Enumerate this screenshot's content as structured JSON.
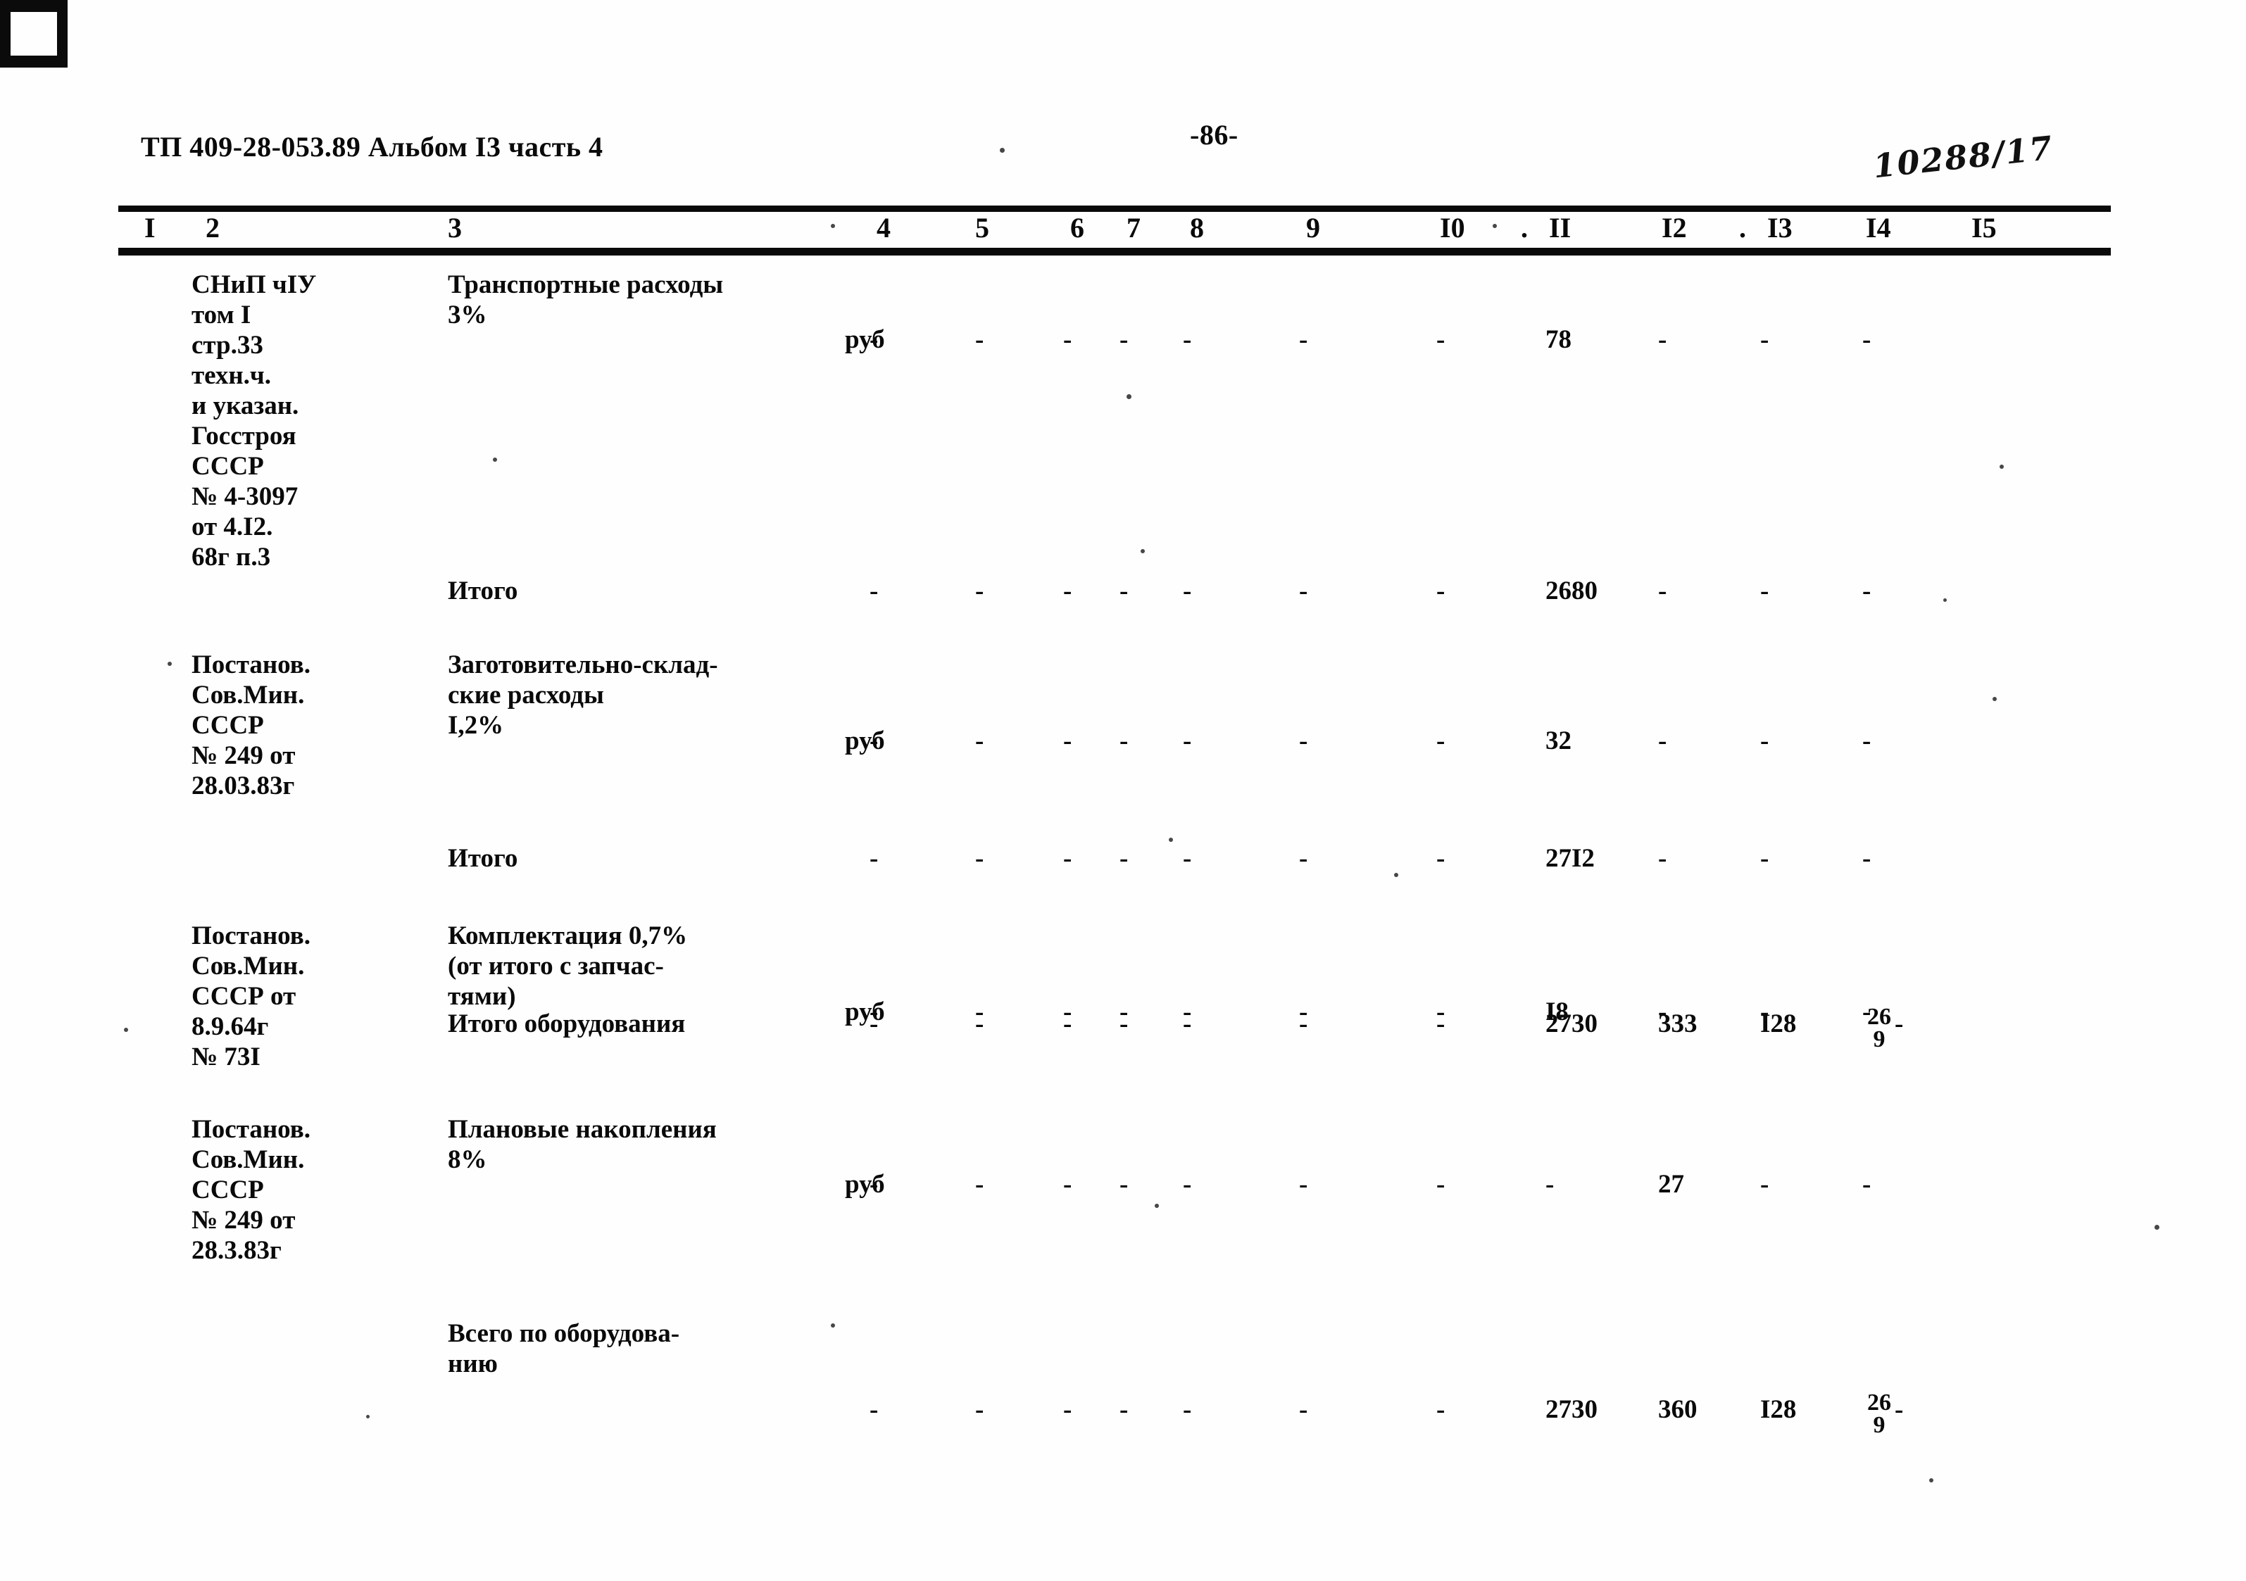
{
  "document": {
    "header_left": "ТП 409-28-053.89 Альбом I3 часть 4",
    "page_number": "-86-",
    "handwritten_note": "10288/17"
  },
  "table": {
    "column_headers": [
      "I",
      "2",
      "3",
      "4",
      "5",
      "6",
      "7",
      "8",
      "9",
      "I0",
      "II",
      "I2",
      "I3",
      "I4",
      "I5"
    ],
    "rows": [
      {
        "id": "row-transport",
        "col2": "СНиП чIУ\nтом I\nстр.33\nтехн.ч.\nи указан.\nГосстроя\nСССР\n№ 4-3097\nот 4.I2.\n68г п.3",
        "col3": "Транспортные расходы\n3%",
        "unit": "руб",
        "values": [
          "-",
          "-",
          "-",
          "-",
          "-",
          "-",
          "-",
          "78",
          "-",
          "-",
          "-"
        ]
      },
      {
        "id": "row-itogo-1",
        "col2": "",
        "col3": "Итого",
        "unit": "",
        "values": [
          "-",
          "-",
          "-",
          "-",
          "-",
          "-",
          "-",
          "2680",
          "-",
          "-",
          "-"
        ]
      },
      {
        "id": "row-zagotovitelno",
        "col2": "Постанов.\nСов.Мин.\nСССР\n№ 249 от\n28.03.83г",
        "col3": "Заготовительно-склад-\nские расходы\nI,2%",
        "unit": "руб",
        "values": [
          "-",
          "-",
          "-",
          "-",
          "-",
          "-",
          "-",
          "32",
          "-",
          "-",
          "-"
        ]
      },
      {
        "id": "row-itogo-2",
        "col2": "",
        "col3": "Итого",
        "unit": "",
        "values": [
          "-",
          "-",
          "-",
          "-",
          "-",
          "-",
          "-",
          "27I2",
          "-",
          "-",
          "-"
        ]
      },
      {
        "id": "row-komplektacia",
        "col2": "Постанов.\nСов.Мин.\nСССР от\n8.9.64г\n№ 73I",
        "col3": "Комплектация 0,7%\n(от итого с запчас-\nтями)",
        "unit": "руб",
        "values": [
          "-",
          "-",
          "-",
          "-",
          "-",
          "-",
          "-",
          "I8",
          "-",
          "-",
          "-"
        ]
      },
      {
        "id": "row-itogo-oborudovania",
        "col2": "",
        "col3": "Итого оборудования",
        "unit": "",
        "values": [
          "-",
          "-",
          "-",
          "-",
          "-",
          "-",
          "-",
          "2730",
          "333",
          "I28",
          "frac"
        ],
        "fraction": {
          "numerator": "26",
          "denominator": "9"
        }
      },
      {
        "id": "row-planovye",
        "col2": "Постанов.\nСов.Мин.\nСССР\n№ 249 от\n28.3.83г",
        "col3": "Плановые накопления\n8%",
        "unit": "руб",
        "values": [
          "-",
          "-",
          "-",
          "-",
          "-",
          "-",
          "-",
          "-",
          "27",
          "-",
          "-"
        ]
      },
      {
        "id": "row-vsego",
        "col2": "",
        "col3": "Всего по оборудова-\nнию",
        "unit": "",
        "values": [
          "-",
          "-",
          "-",
          "-",
          "-",
          "-",
          "-",
          "2730",
          "360",
          "I28",
          "frac"
        ],
        "fraction": {
          "numerator": "26",
          "denominator": "9"
        }
      }
    ]
  }
}
